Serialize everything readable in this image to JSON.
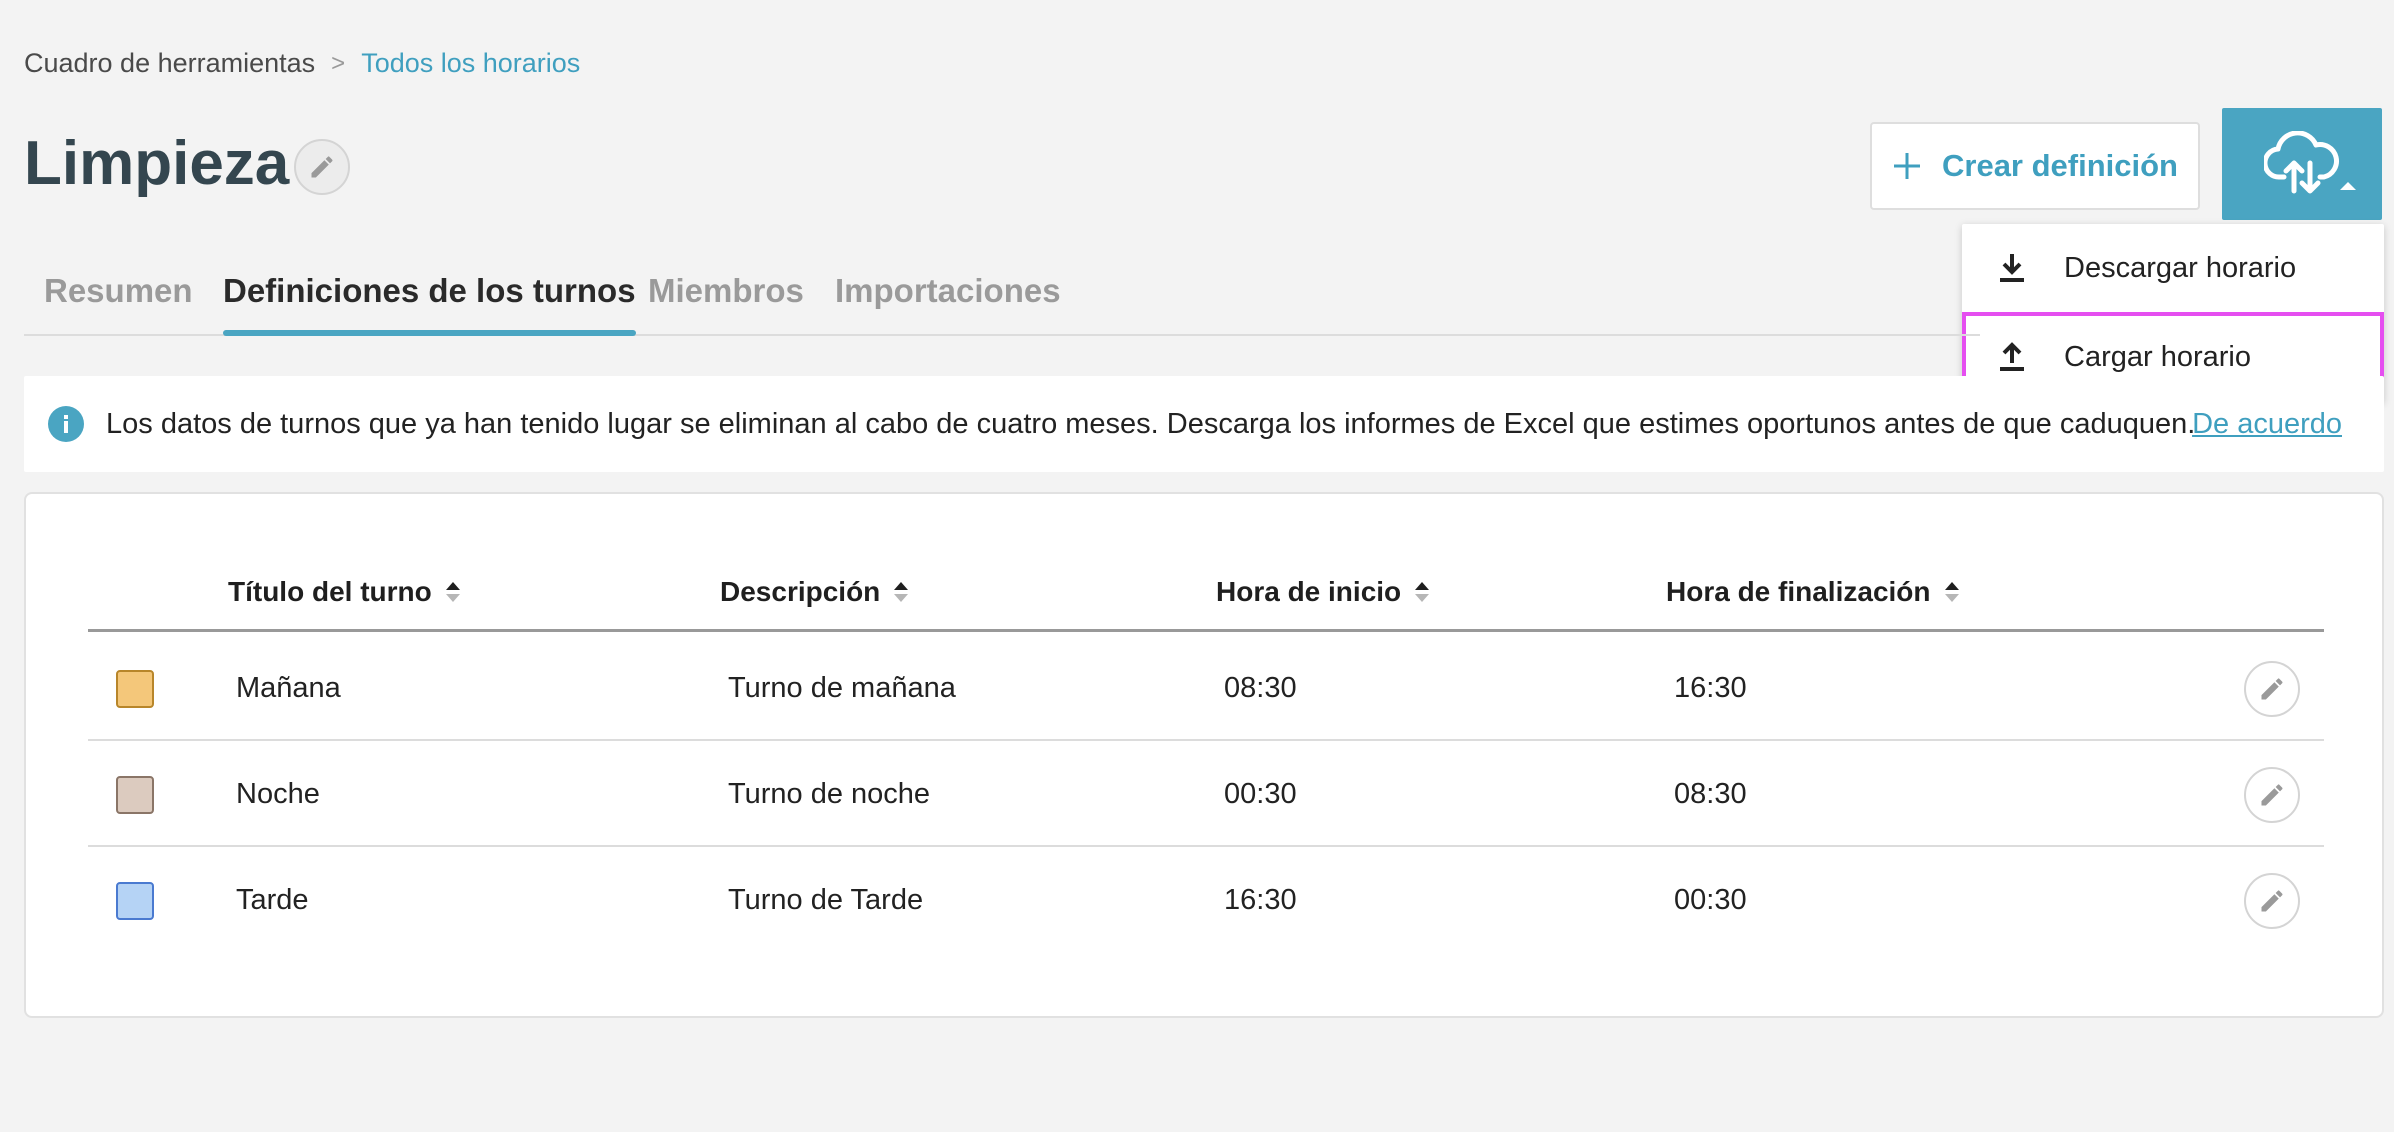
{
  "breadcrumb": {
    "root": "Cuadro de herramientas",
    "separator": ">",
    "current": "Todos los horarios"
  },
  "page": {
    "title": "Limpieza"
  },
  "actions": {
    "create_label": "Crear definición",
    "dropdown": [
      {
        "label": "Descargar horario",
        "icon": "download-icon"
      },
      {
        "label": "Cargar horario",
        "icon": "upload-icon"
      }
    ]
  },
  "tabs": [
    {
      "label": "Resumen",
      "active": false
    },
    {
      "label": "Definiciones de los turnos",
      "active": true
    },
    {
      "label": "Miembros",
      "active": false
    },
    {
      "label": "Importaciones",
      "active": false
    }
  ],
  "notice": {
    "text": "Los datos de turnos que ya han tenido lugar se eliminan al cabo de cuatro meses. Descarga los informes de Excel que estimes oportunos antes de que caduquen.",
    "ack": "De acuerdo"
  },
  "table": {
    "headers": [
      "Título del turno",
      "Descripción",
      "Hora de inicio",
      "Hora de finalización"
    ],
    "rows": [
      {
        "color": "#f4c77a",
        "border": "#b8862a",
        "title": "Mañana",
        "description": "Turno de mañana",
        "start": "08:30",
        "end": "16:30"
      },
      {
        "color": "#dccbbf",
        "border": "#8a7567",
        "title": "Noche",
        "description": "Turno de noche",
        "start": "00:30",
        "end": "08:30"
      },
      {
        "color": "#b5d3f5",
        "border": "#4a7ad0",
        "title": "Tarde",
        "description": "Turno de Tarde",
        "start": "16:30",
        "end": "00:30"
      }
    ]
  },
  "colors": {
    "accent": "#4aa5c2",
    "title": "#34464f",
    "highlight": "#e54ef0"
  }
}
